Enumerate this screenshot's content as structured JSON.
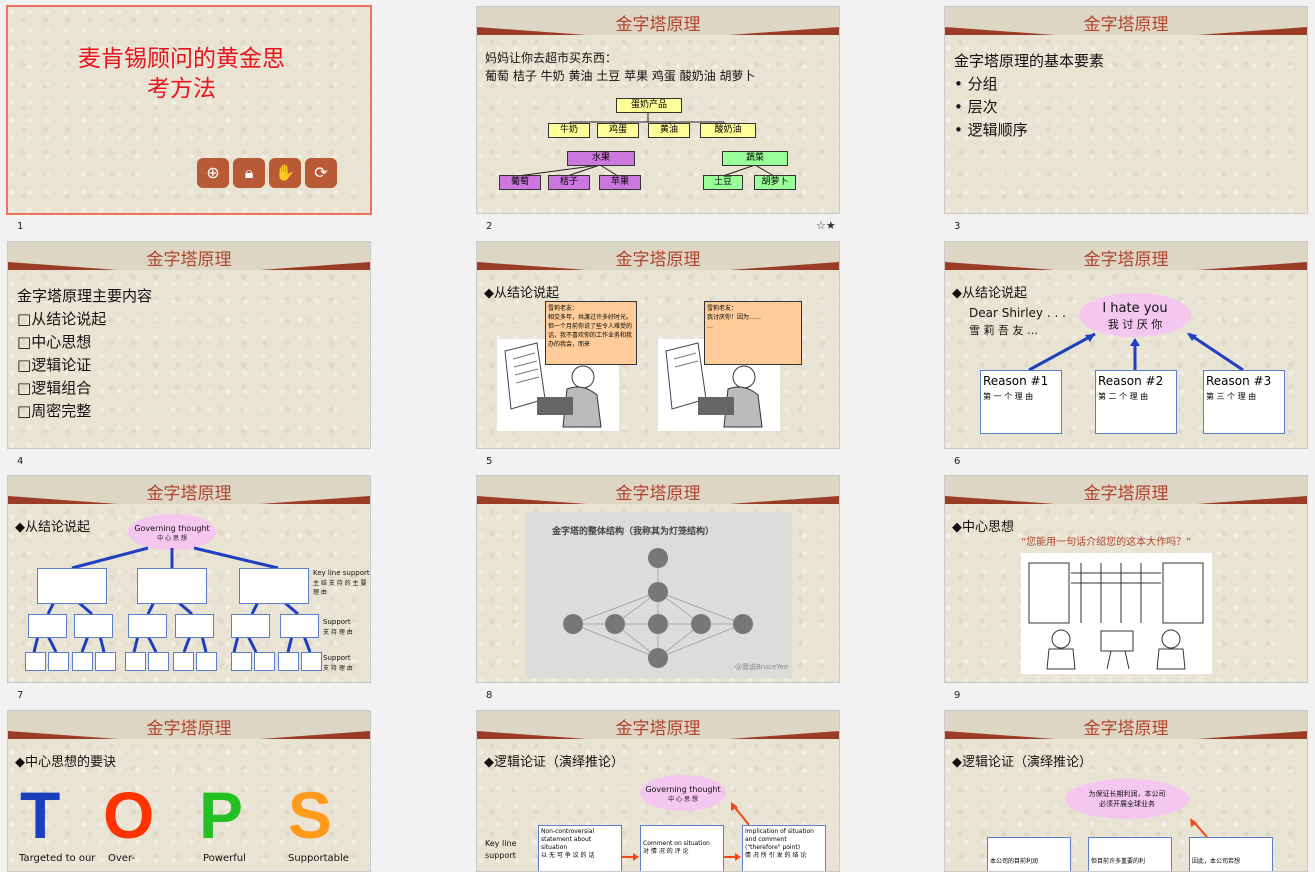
{
  "slides": [
    {
      "number": "1",
      "title": "麦肯锡顾问的黄金思",
      "title2": "考方法",
      "tools": [
        "zoom-icon",
        "lock-icon",
        "like-icon",
        "refresh-icon"
      ]
    },
    {
      "number": "2",
      "header": "金字塔原理",
      "line1": "妈妈让你去超市买东西：",
      "line2": "葡萄 桔子 牛奶 黄油 土豆 苹果 鸡蛋 酸奶油 胡萝卜",
      "dairy": "蛋奶产品",
      "dairy_items": [
        "牛奶",
        "鸡蛋",
        "黄油",
        "酸奶油"
      ],
      "fruit": "水果",
      "fruit_items": [
        "葡萄",
        "桔子",
        "苹果"
      ],
      "veg": "蔬菜",
      "veg_items": [
        "土豆",
        "胡萝卜"
      ]
    },
    {
      "number": "3",
      "header": "金字塔原理",
      "intro": "金字塔原理的基本要素",
      "bullets": [
        "分组",
        "层次",
        "逻辑顺序"
      ]
    },
    {
      "number": "4",
      "header": "金字塔原理",
      "intro": "金字塔原理主要内容",
      "items": [
        "从结论说起",
        "中心思想",
        "逻辑论证",
        "逻辑组合",
        "周密完整"
      ]
    },
    {
      "number": "5",
      "header": "金字塔原理",
      "subtitle": "◆从结论说起",
      "note1": "雪莉老友：\n相交多年，共渡过许多好时光。但一个月前你说了些令人难受的话，我不喜欢你的工作业务和我办的我会，而来",
      "note2": "雪莉老友：\n我讨厌你！因为……\n…"
    },
    {
      "number": "6",
      "header": "金字塔原理",
      "subtitle": "◆从结论说起",
      "dear": "Dear Shirley . . .",
      "dear_cn": "雪 莉 吾 友 …",
      "hate": "I hate you",
      "hate_cn": "我 讨 厌 你",
      "reasons": [
        {
          "en": "Reason #1",
          "cn": "第 一 个 理 由"
        },
        {
          "en": "Reason #2",
          "cn": "第 二 个 理 由"
        },
        {
          "en": "Reason #3",
          "cn": "第 三 个 理 由"
        }
      ]
    },
    {
      "number": "7",
      "header": "金字塔原理",
      "subtitle": "◆从结论说起",
      "gov": "Governing thought",
      "gov_cn": "中 心 思 想",
      "key_en": "Key line support",
      "key_cn": "主 结 支 持 的 主 要 理 由",
      "support1_en": "Support",
      "support1_cn": "支 持 理 由",
      "support2_en": "Support",
      "support2_cn": "支 持 理 由"
    },
    {
      "number": "8",
      "header": "金字塔原理",
      "img_title": "金字塔的整体结构（我称其为灯笼结构）",
      "watermark": "@我说BruceYee"
    },
    {
      "number": "9",
      "header": "金字塔原理",
      "subtitle": "◆中心思想",
      "quote": "“您能用一句话介绍您的这本大作吗？”"
    },
    {
      "number": "10",
      "header": "金字塔原理",
      "subtitle": "◆中心思想的要诀",
      "letters": [
        {
          "l": "T",
          "c": "#1a3fbf",
          "w": "Targeted to our"
        },
        {
          "l": "O",
          "c": "#ff3300",
          "w": "Over-"
        },
        {
          "l": "P",
          "c": "#22c022",
          "w": "Powerful"
        },
        {
          "l": "S",
          "c": "#ff9a1a",
          "w": "Supportable"
        }
      ]
    },
    {
      "number": "11",
      "header": "金字塔原理",
      "subtitle": "◆逻辑论证（演绎推论）",
      "gov": "Governing thought",
      "gov_cn": "中 心 思 想",
      "key": "Key line",
      "key2": "support",
      "b1": "Non-controversial statement about situation",
      "b1_cn": "以 无 可 争 议 的 话",
      "b2": "Comment on situation",
      "b2_cn": "对 情 况 的 评 论",
      "b3": "Implication of situation and comment (\"therefore\" point)",
      "b3_cn": "情 况 所 引 发 的 结 论"
    },
    {
      "number": "12",
      "header": "金字塔原理",
      "subtitle": "◆逻辑论证（演绎推论）",
      "oval1": "为保证长期利润，本公司",
      "oval2": "必须开展全球业务",
      "c1": "本公司的目前利润",
      "c2": "但目前许多重要的利",
      "c3": "因此，本公司若想"
    }
  ]
}
